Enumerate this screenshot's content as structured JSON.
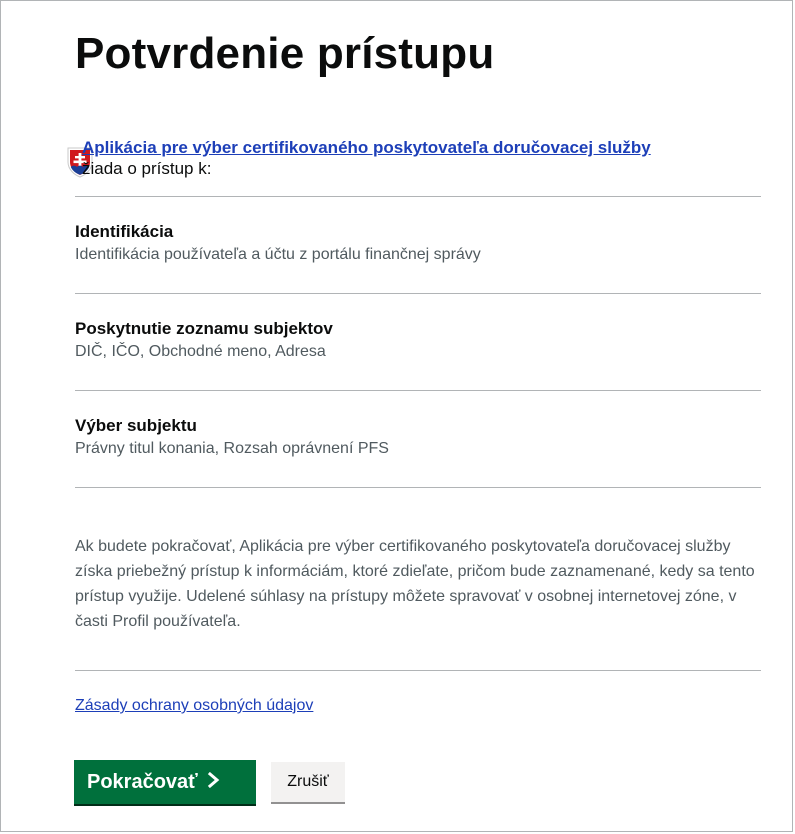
{
  "page": {
    "title": "Potvrdenie prístupu"
  },
  "requester": {
    "app_name": "Aplikácia pre výber certifikovaného poskytovateľa doručovacej služby",
    "request_text": "žiada o prístup k:"
  },
  "scopes": [
    {
      "title": "Identifikácia",
      "description": "Identifikácia používateľa a účtu z portálu finančnej správy"
    },
    {
      "title": "Poskytnutie zoznamu subjektov",
      "description": "DIČ, IČO, Obchodné meno, Adresa"
    },
    {
      "title": "Výber subjektu",
      "description": "Právny titul konania, Rozsah oprávnení PFS"
    }
  ],
  "notice": "Ak budete pokračovať, Aplikácia pre výber certifikovaného poskytovateľa doručovacej služby získa priebežný prístup k informáciám, ktoré zdieľate, pričom bude zaznamenané, kedy sa tento prístup využije. Udelené súhlasy na prístupy môžete spravovať v osobnej internetovej zóne, v časti Profil používateľa.",
  "policy_link": "Zásady ochrany osobných údajov",
  "actions": {
    "continue_label": "Pokračovať",
    "continue_icon": "chevron-right-icon",
    "cancel_label": "Zrušiť"
  },
  "colors": {
    "primary_button": "#00703c",
    "link": "#1d3fb8",
    "muted_text": "#505a5f",
    "divider": "#b1b4b6",
    "emblem_red": "#d0191e",
    "emblem_blue": "#1b3f96"
  },
  "icons": {
    "requester_emblem": "slovak-coat-of-arms-icon"
  }
}
